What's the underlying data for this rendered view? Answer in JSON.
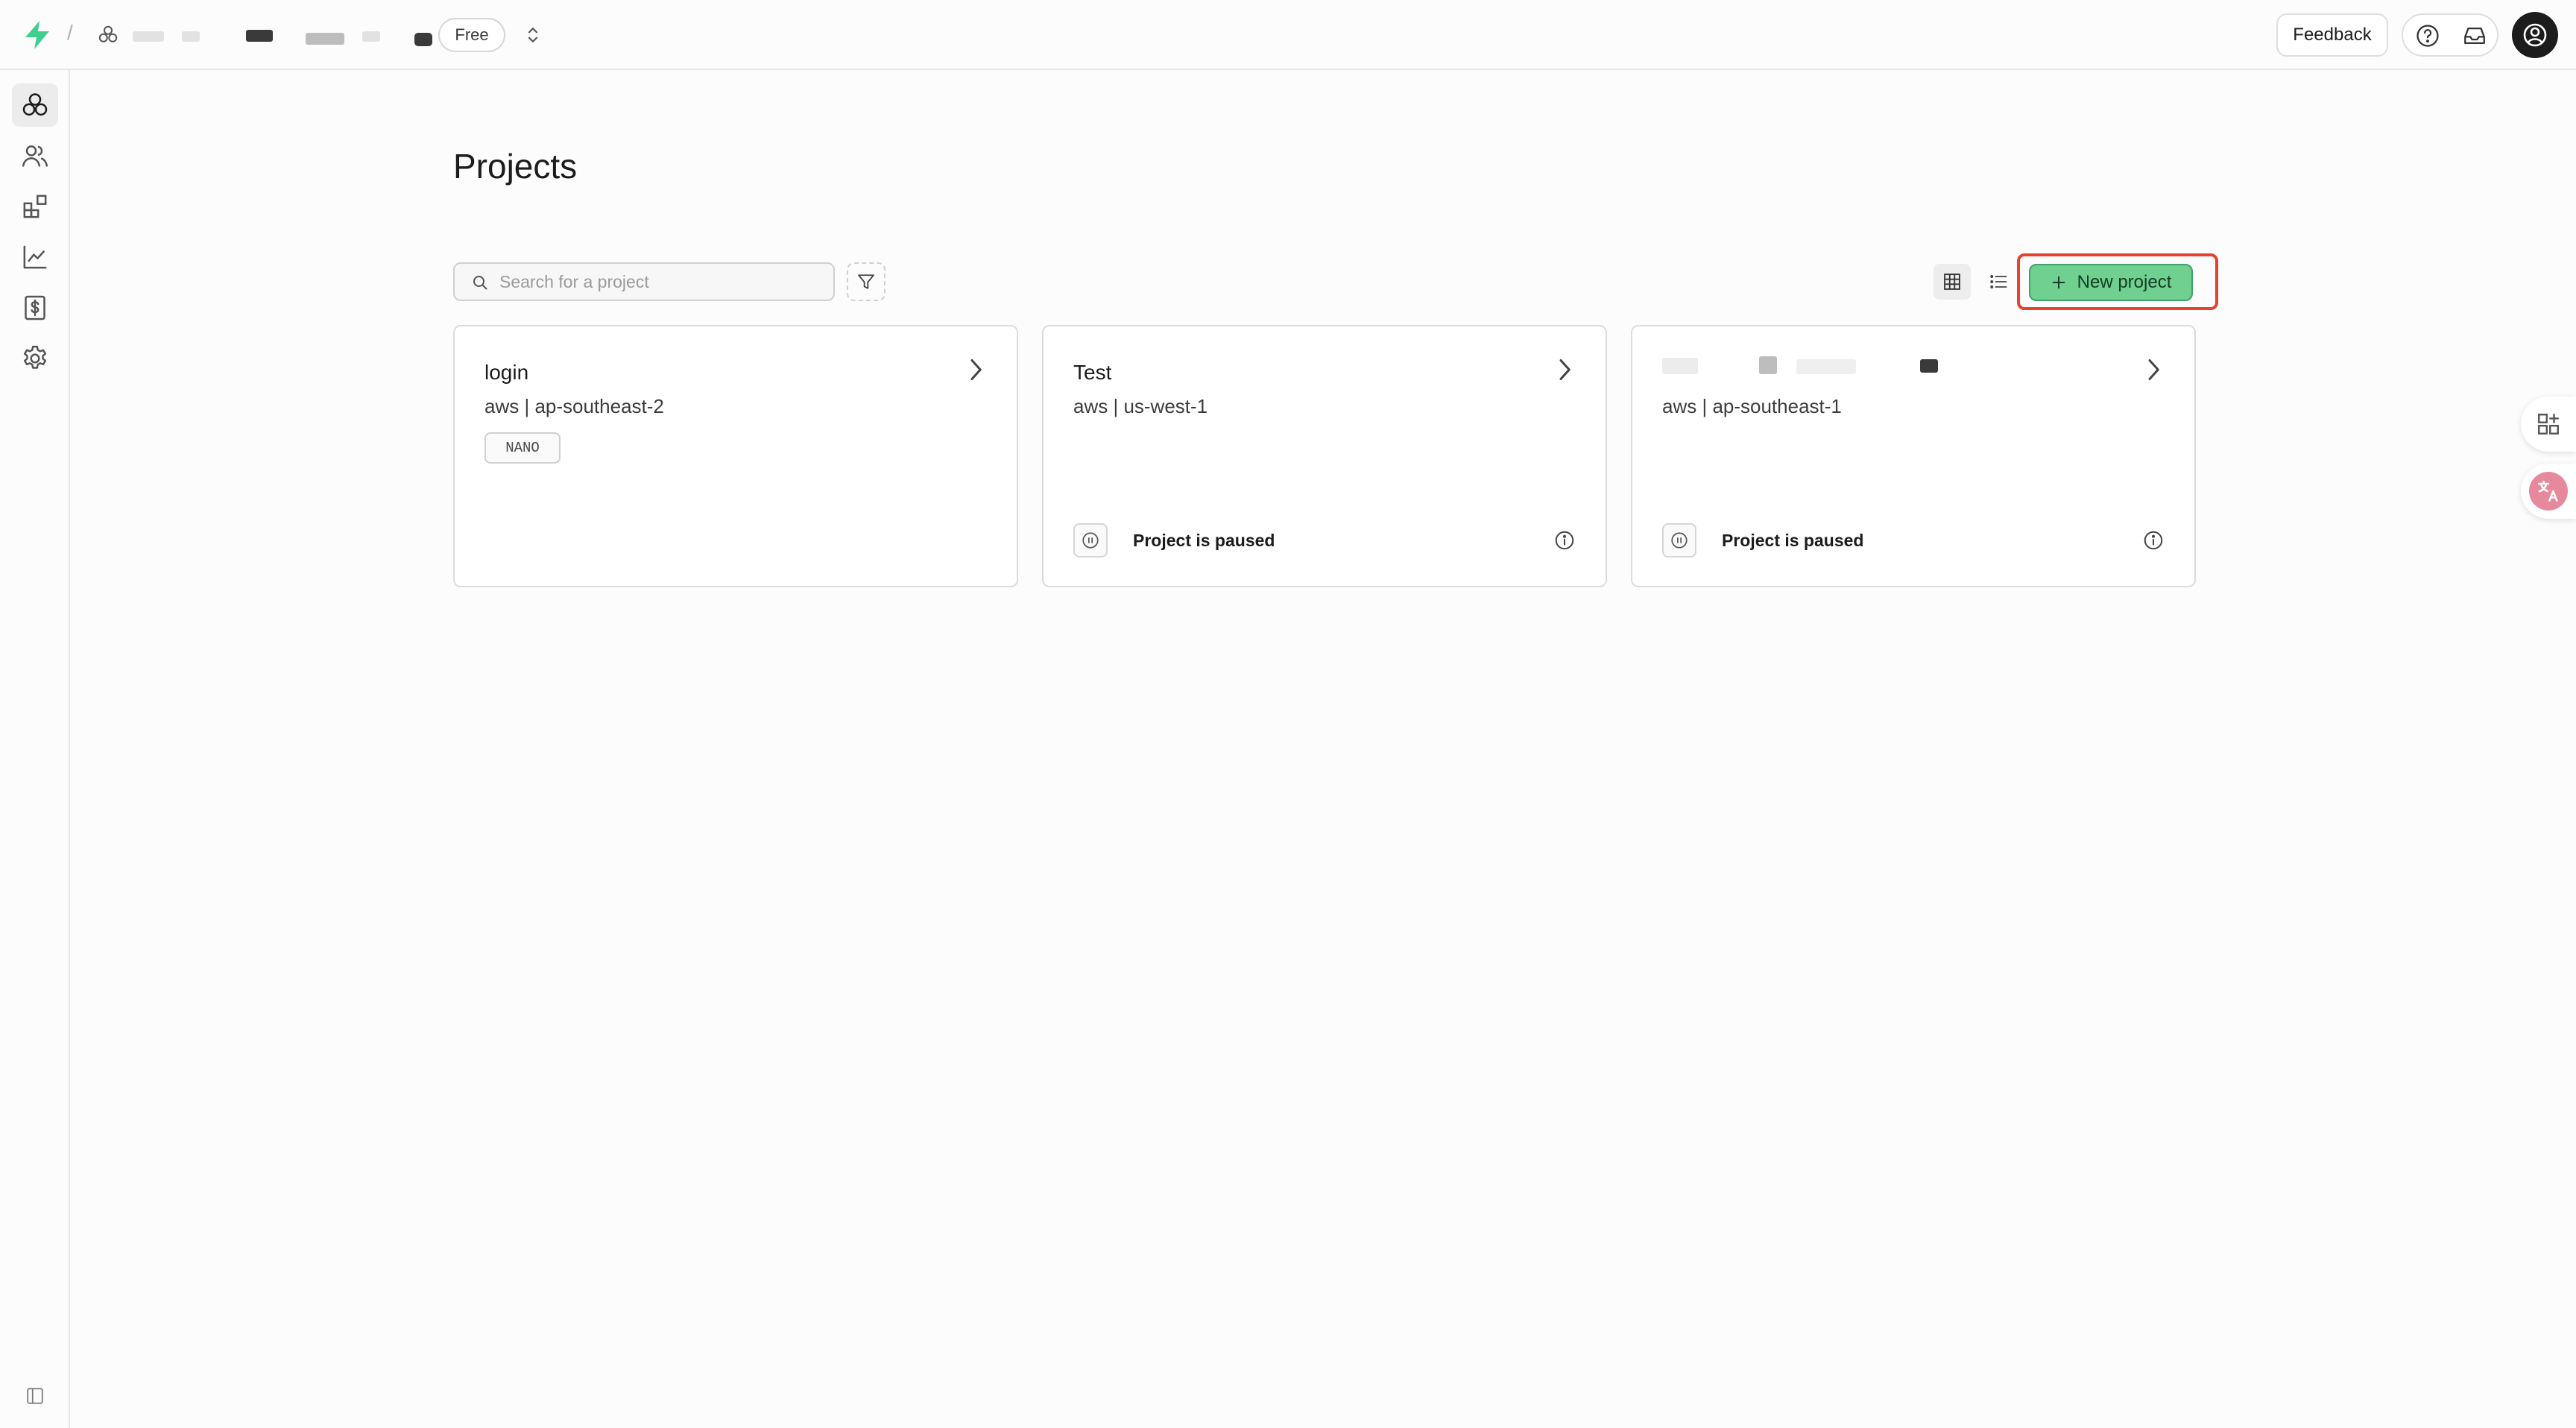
{
  "header": {
    "breadcrumb_separator": "/",
    "plan_badge": "Free",
    "feedback_label": "Feedback"
  },
  "sidebar": {
    "items": [
      {
        "name": "projects",
        "icon": "projects-icon",
        "active": true
      },
      {
        "name": "team",
        "icon": "users-icon",
        "active": false
      },
      {
        "name": "integrations",
        "icon": "integrations-icon",
        "active": false
      },
      {
        "name": "usage",
        "icon": "chart-icon",
        "active": false
      },
      {
        "name": "billing",
        "icon": "billing-icon",
        "active": false
      },
      {
        "name": "settings",
        "icon": "gear-icon",
        "active": false
      }
    ]
  },
  "main": {
    "title": "Projects",
    "search": {
      "placeholder": "Search for a project",
      "value": ""
    },
    "new_project_label": "New project",
    "projects": [
      {
        "name": "login",
        "region": "aws | ap-southeast-2",
        "badge": "NANO",
        "status": ""
      },
      {
        "name": "Test",
        "region": "aws | us-west-1",
        "badge": "",
        "status": "Project is paused"
      },
      {
        "name": "",
        "region": "aws | ap-southeast-1",
        "badge": "",
        "status": "Project is paused"
      }
    ]
  },
  "colors": {
    "brand": "#3ecf8e",
    "primary_button": "#6fd08f",
    "highlight_border": "#e5432f"
  }
}
